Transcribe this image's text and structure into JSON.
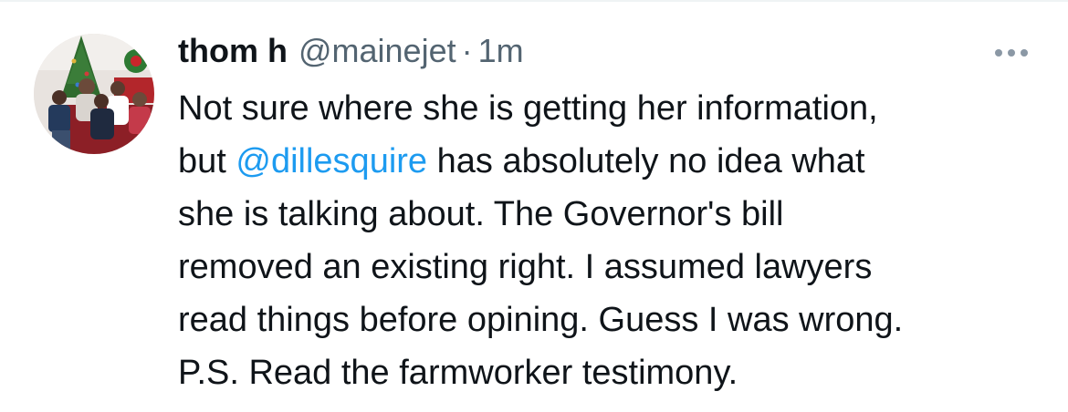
{
  "tweet": {
    "author": {
      "display_name": "thom h",
      "handle": "@mainejet",
      "avatar_icon": "avatar-photo-icon"
    },
    "separator": "·",
    "time": "1m",
    "more_icon": "more-options-icon",
    "text_lines": [
      {
        "before": "Not sure where she is getting her information,",
        "mention": "",
        "after": ""
      },
      {
        "before": "but ",
        "mention": "@dillesquire",
        "after": " has absolutely no idea what"
      },
      {
        "before": "she is talking about. The Governor's bill",
        "mention": "",
        "after": ""
      },
      {
        "before": "removed an existing right. I assumed lawyers",
        "mention": "",
        "after": ""
      },
      {
        "before": "read things before opining. Guess I was wrong.",
        "mention": "",
        "after": ""
      },
      {
        "before": "P.S. Read the farmworker testimony.",
        "mention": "",
        "after": ""
      }
    ]
  },
  "colors": {
    "text": "#0f1419",
    "secondary": "#536471",
    "mention": "#1d9bf0",
    "divider": "#eff3f4"
  }
}
